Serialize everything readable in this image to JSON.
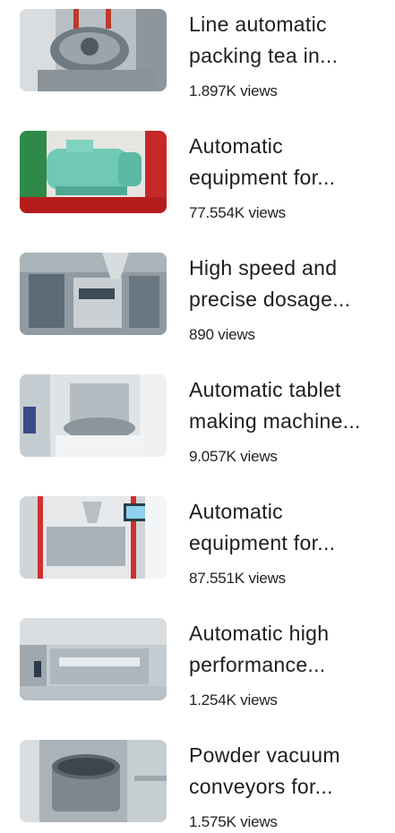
{
  "videos": [
    {
      "title_line1": "Line automatic",
      "title_line2": "packing tea in...",
      "views": "1.897K views",
      "thumbnail": "rotary-tablet-press-closeup"
    },
    {
      "title_line1": "Automatic",
      "title_line2": "equipment for...",
      "views": "77.554K views",
      "thumbnail": "teal-electric-motor"
    },
    {
      "title_line1": "High speed and",
      "title_line2": "precise dosage...",
      "views": "890 views",
      "thumbnail": "capsule-filling-line"
    },
    {
      "title_line1": "Automatic tablet",
      "title_line2": "making machine...",
      "views": "9.057K views",
      "thumbnail": "tablet-press-exhibition"
    },
    {
      "title_line1": "Automatic",
      "title_line2": "equipment for...",
      "views": "87.551K views",
      "thumbnail": "capsule-filler-cabinet"
    },
    {
      "title_line1": "Automatic high",
      "title_line2": "performance...",
      "views": "1.254K views",
      "thumbnail": "blister-packing-line"
    },
    {
      "title_line1": "Powder vacuum",
      "title_line2": "conveyors for...",
      "views": "1.575K views",
      "thumbnail": "vacuum-conveyor-filter"
    }
  ]
}
